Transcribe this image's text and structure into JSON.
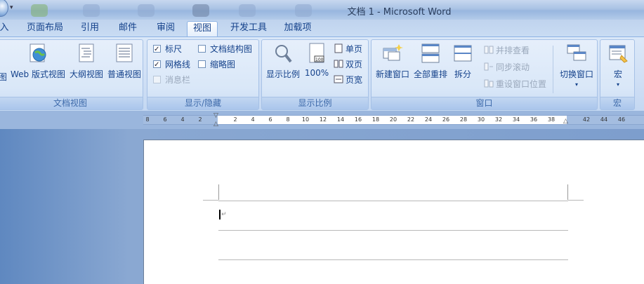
{
  "window": {
    "title": "文档 1 - Microsoft Word"
  },
  "tabs": [
    {
      "label": "入"
    },
    {
      "label": "页面布局"
    },
    {
      "label": "引用"
    },
    {
      "label": "邮件"
    },
    {
      "label": "审阅"
    },
    {
      "label": "视图",
      "active": true
    },
    {
      "label": "开发工具"
    },
    {
      "label": "加载项"
    }
  ],
  "groups": {
    "doc_views": {
      "label": "文档视图",
      "buttons": [
        {
          "label": "图"
        },
        {
          "label": "Web 版式视图"
        },
        {
          "label": "大纲视图"
        },
        {
          "label": "普通视图"
        }
      ]
    },
    "show_hide": {
      "label": "显示/隐藏",
      "ruler": {
        "label": "标尺",
        "checked": true
      },
      "gridlines": {
        "label": "网格线",
        "checked": true
      },
      "message_bar": {
        "label": "消息栏",
        "checked": false,
        "disabled": true
      },
      "doc_map": {
        "label": "文档结构图",
        "checked": false
      },
      "thumbnails": {
        "label": "缩略图",
        "checked": false
      }
    },
    "zoom": {
      "label": "显示比例",
      "zoom_button": {
        "label": "显示比例"
      },
      "hundred": {
        "label": "100%"
      },
      "one_page": {
        "label": "单页"
      },
      "two_pages": {
        "label": "双页"
      },
      "page_width": {
        "label": "页宽"
      }
    },
    "window": {
      "label": "窗口",
      "new_window": {
        "label": "新建窗口"
      },
      "arrange_all": {
        "label": "全部重排"
      },
      "split": {
        "label": "拆分"
      },
      "side_by_side": {
        "label": "并排查看"
      },
      "sync_scroll": {
        "label": "同步滚动"
      },
      "reset_position": {
        "label": "重设窗口位置"
      },
      "switch_windows": {
        "label": "切换窗口"
      }
    },
    "macros": {
      "label": "宏",
      "macros_button": {
        "label": "宏"
      }
    }
  },
  "ruler": {
    "ticks": [
      "8",
      "6",
      "4",
      "2",
      "2",
      "4",
      "6",
      "8",
      "10",
      "12",
      "14",
      "16",
      "18",
      "20",
      "22",
      "24",
      "26",
      "28",
      "30",
      "32",
      "34",
      "36",
      "38",
      "42",
      "44",
      "46"
    ]
  },
  "colors": {
    "ribbon_text": "#15428b",
    "ribbon_bg": "#cfdff5",
    "doc_bg": "#7d9ecd"
  }
}
